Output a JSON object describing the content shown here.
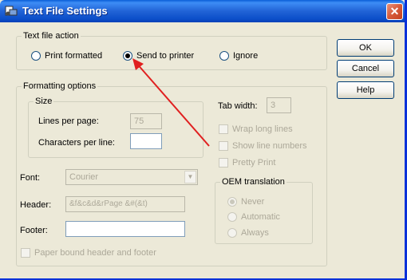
{
  "window": {
    "title": "Text File Settings",
    "close_label": "✕"
  },
  "text_file_action": {
    "legend": "Text file action",
    "options": [
      {
        "label": "Print formatted",
        "checked": false
      },
      {
        "label": "Send to printer",
        "checked": true
      },
      {
        "label": "Ignore",
        "checked": false
      }
    ]
  },
  "formatting": {
    "legend": "Formatting options",
    "size": {
      "legend": "Size",
      "lines_per_page_label": "Lines per page:",
      "lines_per_page_value": "75",
      "chars_per_line_label": "Characters per line:",
      "chars_per_line_value": ""
    },
    "tab_width_label": "Tab width:",
    "tab_width_value": "3",
    "wrap_long_lines": "Wrap long lines",
    "show_line_numbers": "Show line numbers",
    "pretty_print": "Pretty Print",
    "font_label": "Font:",
    "font_value": "Courier",
    "header_label": "Header:",
    "header_value": "&f&c&d&rPage &#(&t)",
    "footer_label": "Footer:",
    "footer_value": "",
    "paper_bound": "Paper bound header and footer",
    "oem": {
      "legend": "OEM translation",
      "options": [
        {
          "label": "Never",
          "checked": true
        },
        {
          "label": "Automatic",
          "checked": false
        },
        {
          "label": "Always",
          "checked": false
        }
      ]
    }
  },
  "buttons": {
    "ok": "OK",
    "cancel": "Cancel",
    "help": "Help"
  },
  "annotation": {
    "arrow_color": "#e02020"
  }
}
